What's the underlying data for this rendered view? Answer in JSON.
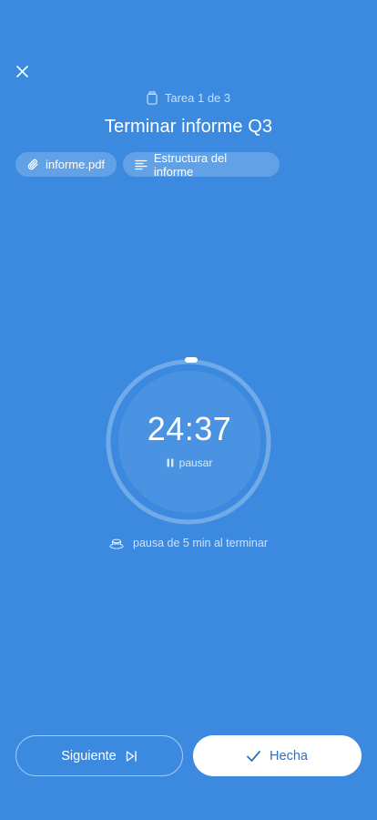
{
  "header": {
    "close_icon": "close-icon",
    "task_counter": "Tarea 1 de 3",
    "task_title": "Terminar informe Q3"
  },
  "attachments": [
    {
      "label": "informe.pdf",
      "icon": "paperclip-icon"
    },
    {
      "label": "Estructura del informe",
      "icon": "text-lines-icon"
    }
  ],
  "timer": {
    "value": "24:37",
    "pause_label": "pausar",
    "progress_fraction": 0.02
  },
  "break_note": "pausa de 5 min al terminar",
  "footer": {
    "next_label": "Siguiente",
    "done_label": "Hecha"
  },
  "colors": {
    "background": "#3B8AE0",
    "done_text": "#2F6FC4"
  }
}
